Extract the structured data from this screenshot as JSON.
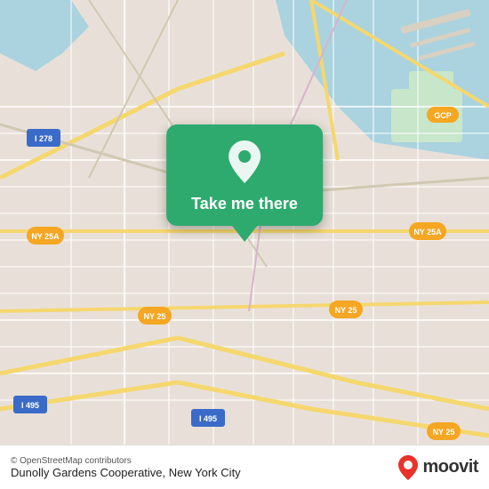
{
  "map": {
    "background_color": "#e8e0d8",
    "center_lat": 40.737,
    "center_lon": -73.88
  },
  "button": {
    "label": "Take me there",
    "background_color": "#2eaa6e"
  },
  "bottom_bar": {
    "osm_credit": "© OpenStreetMap contributors",
    "location_name": "Dunolly Gardens Cooperative, New York City",
    "logo_text": "moovit"
  },
  "road_labels": [
    "I 278",
    "I 495",
    "NY 25A",
    "NY 25",
    "GCP",
    "NY 25A"
  ]
}
